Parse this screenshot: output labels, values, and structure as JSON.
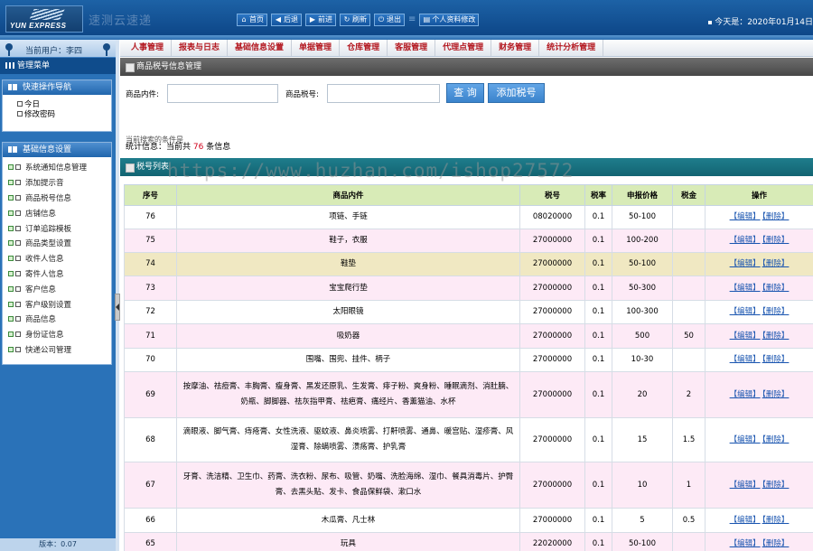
{
  "header": {
    "logo_text": "YUN EXPRESS",
    "system_title": "速测云速递",
    "buttons": [
      {
        "icon": "home-icon",
        "glyph": "⌂",
        "label": "首页"
      },
      {
        "icon": "back-icon",
        "glyph": "◀",
        "label": "后退"
      },
      {
        "icon": "forward-icon",
        "glyph": "▶",
        "label": "前进"
      },
      {
        "icon": "refresh-icon",
        "glyph": "↻",
        "label": "刷新"
      },
      {
        "icon": "logout-icon",
        "glyph": "⏻",
        "label": "退出"
      },
      {
        "icon": "profile-icon",
        "glyph": "▤",
        "label": "个人资料修改"
      }
    ],
    "today": "今天是：2020年01月14日"
  },
  "sidebar": {
    "current_user": "当前用户：李四",
    "menu_title": "管理菜单",
    "quick_nav": {
      "title": "快速操作导航",
      "items": [
        "今日",
        "修改密码"
      ]
    },
    "basic_settings": {
      "title": "基础信息设置",
      "items": [
        "系统通知信息管理",
        "添加提示音",
        "商品税号信息",
        "店铺信息",
        "订单追踪模板",
        "商品类型设置",
        "收件人信息",
        "寄件人信息",
        "客户信息",
        "客户级别设置",
        "商品信息",
        "身份证信息",
        "快递公司管理"
      ]
    },
    "version": "版本：0.07"
  },
  "nav_tabs": [
    "人事管理",
    "报表与日志",
    "基础信息设置",
    "单据管理",
    "仓库管理",
    "客服管理",
    "代理点管理",
    "财务管理",
    "统计分析管理"
  ],
  "main": {
    "section_title": "商品税号信息管理",
    "search": {
      "content_label": "商品内件:",
      "content_value": "",
      "taxno_label": "商品税号:",
      "taxno_value": "",
      "query_button": "查 询",
      "add_button": "添加税号"
    },
    "hint": "当前搜索的条件是",
    "stats_prefix": "统计信息：当前共",
    "stats_count": "76",
    "stats_suffix": "条信息",
    "list_title": "税号列表",
    "table": {
      "columns": [
        "序号",
        "商品内件",
        "税号",
        "税率",
        "申报价格",
        "税金",
        "操作"
      ],
      "edit_label": "【编辑】",
      "delete_label": "【删除】",
      "rows": [
        {
          "id": "76",
          "content": "项链、手链",
          "taxno": "08020000",
          "rate": "0.1",
          "price": "50-100",
          "tax": "",
          "style": "white"
        },
        {
          "id": "75",
          "content": "鞋子，衣服",
          "taxno": "27000000",
          "rate": "0.1",
          "price": "100-200",
          "tax": "",
          "style": "pink"
        },
        {
          "id": "74",
          "content": "鞋垫",
          "taxno": "27000000",
          "rate": "0.1",
          "price": "50-100",
          "tax": "",
          "style": "hl"
        },
        {
          "id": "73",
          "content": "宝宝爬行垫",
          "taxno": "27000000",
          "rate": "0.1",
          "price": "50-300",
          "tax": "",
          "style": "pink"
        },
        {
          "id": "72",
          "content": "太阳眼镜",
          "taxno": "27000000",
          "rate": "0.1",
          "price": "100-300",
          "tax": "",
          "style": "white"
        },
        {
          "id": "71",
          "content": "吸奶器",
          "taxno": "27000000",
          "rate": "0.1",
          "price": "500",
          "tax": "50",
          "style": "pink"
        },
        {
          "id": "70",
          "content": "围嘴、围兜、挂件、柄子",
          "taxno": "27000000",
          "rate": "0.1",
          "price": "10-30",
          "tax": "",
          "style": "white"
        },
        {
          "id": "69",
          "content": "按摩油、祛痘膏、丰胸膏、瘦身膏、黑发还原乳、生发膏、痱子粉、爽身粉、睡眠滴剂、消肚腩、奶瓶、脚脚器、祛灰指甲膏、祛疤膏、痛经片、香薰猫油、水杯",
          "taxno": "27000000",
          "rate": "0.1",
          "price": "20",
          "tax": "2",
          "style": "pink"
        },
        {
          "id": "68",
          "content": "滴眼液、脚气膏、痔疮膏、女性洗液、驱蚊液、鼻炎喷雾、打鼾喷雾、通鼻、暖宫贴、湿疹膏、风湿膏、除螨喷雾、溃疡膏、护乳膏",
          "taxno": "27000000",
          "rate": "0.1",
          "price": "15",
          "tax": "1.5",
          "style": "white"
        },
        {
          "id": "67",
          "content": "牙膏、洗洁精、卫生巾、药膏、洗衣粉、尿布、吸管、奶嘴、洗脸海绵、湿巾、餐具消毒片、护臀膏、去黑头贴、发卡、食品保鲜袋、漱口水",
          "taxno": "27000000",
          "rate": "0.1",
          "price": "10",
          "tax": "1",
          "style": "pink"
        },
        {
          "id": "66",
          "content": "木瓜膏、凡士林",
          "taxno": "27000000",
          "rate": "0.1",
          "price": "5",
          "tax": "0.5",
          "style": "white"
        },
        {
          "id": "65",
          "content": "玩具",
          "taxno": "22020000",
          "rate": "0.1",
          "price": "50-100",
          "tax": "",
          "style": "pink"
        }
      ]
    }
  },
  "watermark": "https://www.huzhan.com/ishop27572"
}
